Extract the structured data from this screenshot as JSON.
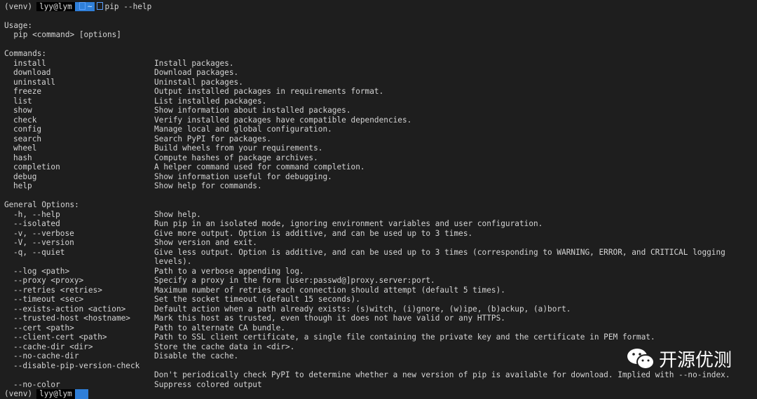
{
  "prompt": {
    "venv": "(venv)",
    "user": "lyy@lym",
    "dir": "~",
    "command": "pip --help"
  },
  "usage": {
    "title": "Usage:",
    "syntax": "  pip <command> [options]"
  },
  "commands_title": "Commands:",
  "commands": [
    [
      "install",
      "Install packages."
    ],
    [
      "download",
      "Download packages."
    ],
    [
      "uninstall",
      "Uninstall packages."
    ],
    [
      "freeze",
      "Output installed packages in requirements format."
    ],
    [
      "list",
      "List installed packages."
    ],
    [
      "show",
      "Show information about installed packages."
    ],
    [
      "check",
      "Verify installed packages have compatible dependencies."
    ],
    [
      "config",
      "Manage local and global configuration."
    ],
    [
      "search",
      "Search PyPI for packages."
    ],
    [
      "wheel",
      "Build wheels from your requirements."
    ],
    [
      "hash",
      "Compute hashes of package archives."
    ],
    [
      "completion",
      "A helper command used for command completion."
    ],
    [
      "debug",
      "Show information useful for debugging."
    ],
    [
      "help",
      "Show help for commands."
    ]
  ],
  "options_title": "General Options:",
  "options": [
    [
      "-h, --help",
      "Show help."
    ],
    [
      "--isolated",
      "Run pip in an isolated mode, ignoring environment variables and user configuration."
    ],
    [
      "-v, --verbose",
      "Give more output. Option is additive, and can be used up to 3 times."
    ],
    [
      "-V, --version",
      "Show version and exit."
    ],
    [
      "-q, --quiet",
      "Give less output. Option is additive, and can be used up to 3 times (corresponding to WARNING, ERROR, and CRITICAL logging"
    ],
    [
      "",
      "levels)."
    ],
    [
      "--log <path>",
      "Path to a verbose appending log."
    ],
    [
      "--proxy <proxy>",
      "Specify a proxy in the form [user:passwd@]proxy.server:port."
    ],
    [
      "--retries <retries>",
      "Maximum number of retries each connection should attempt (default 5 times)."
    ],
    [
      "--timeout <sec>",
      "Set the socket timeout (default 15 seconds)."
    ],
    [
      "--exists-action <action>",
      "Default action when a path already exists: (s)witch, (i)gnore, (w)ipe, (b)ackup, (a)bort."
    ],
    [
      "--trusted-host <hostname>",
      "Mark this host as trusted, even though it does not have valid or any HTTPS."
    ],
    [
      "--cert <path>",
      "Path to alternate CA bundle."
    ],
    [
      "--client-cert <path>",
      "Path to SSL client certificate, a single file containing the private key and the certificate in PEM format."
    ],
    [
      "--cache-dir <dir>",
      "Store the cache data in <dir>."
    ],
    [
      "--no-cache-dir",
      "Disable the cache."
    ],
    [
      "--disable-pip-version-check",
      ""
    ],
    [
      "",
      "Don't periodically check PyPI to determine whether a new version of pip is available for download. Implied with --no-index."
    ],
    [
      "--no-color",
      "Suppress colored output"
    ]
  ],
  "watermark": {
    "icon": "wechat-icon",
    "text": "开源优测"
  }
}
